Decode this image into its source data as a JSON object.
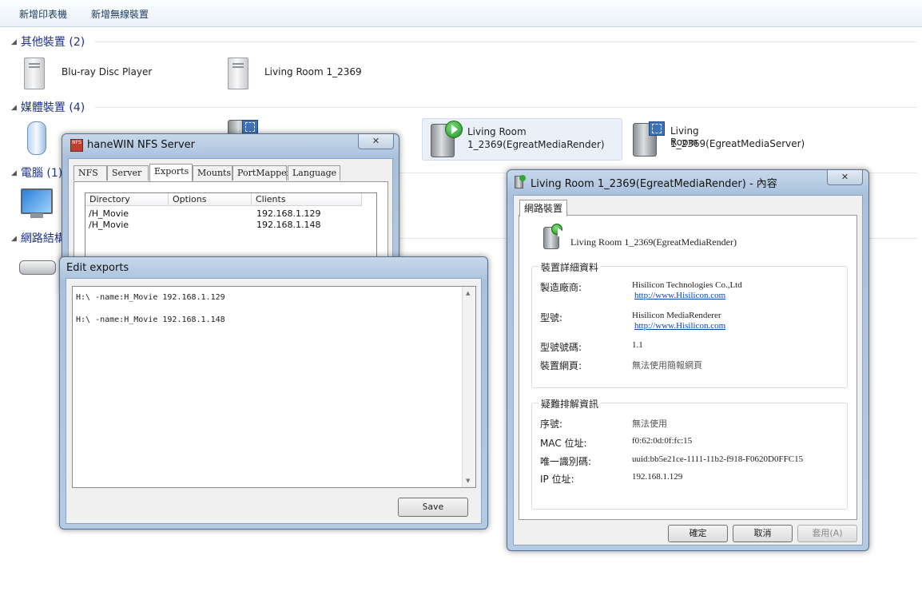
{
  "toolbar": {
    "add_printer": "新增印表機",
    "add_wireless": "新增無線裝置"
  },
  "groups": {
    "other": "其他裝置 (2)",
    "media": "媒體裝置 (4)",
    "computer": "電腦 (1)",
    "network": "網路結構"
  },
  "devices": {
    "bluray": "Blu-ray Disc Player",
    "living_room": "Living Room 1_2369",
    "media_render_line1": "Living Room",
    "media_render_line2": "1_2369(EgreatMediaRender)",
    "media_server_line1": "Living Room",
    "media_server_line2": "1_2369(EgreatMediaServer)"
  },
  "nfs": {
    "title": "haneWIN NFS Server",
    "close": "✕",
    "tabs": [
      "NFS",
      "Server",
      "Exports",
      "Mounts",
      "PortMapper",
      "Language"
    ],
    "columns": [
      "Directory",
      "Options",
      "Clients"
    ],
    "rows": [
      {
        "dir": "/H_Movie",
        "options": "",
        "clients": "192.168.1.129"
      },
      {
        "dir": "/H_Movie",
        "options": "",
        "clients": "192.168.1.148"
      }
    ]
  },
  "edit": {
    "title": "Edit exports",
    "line1": "H:\\ -name:H_Movie 192.168.1.129",
    "line2": "H:\\ -name:H_Movie 192.168.1.148",
    "save": "Save"
  },
  "props": {
    "title": "Living Room 1_2369(EgreatMediaRender) - 內容",
    "close": "✕",
    "tab": "網路裝置",
    "device_name": "Living Room 1_2369(EgreatMediaRender)",
    "details_header": "裝置詳細資料",
    "manufacturer_label": "製造廠商:",
    "manufacturer_value": "Hisilicon Technologies Co.,Ltd",
    "manufacturer_link": "http://www.Hisilicon.com",
    "model_label": "型號:",
    "model_value": "Hisilicon MediaRenderer",
    "model_link": "http://www.Hisilicon.com",
    "model_no_label": "型號號碼:",
    "model_no_value": "1.1",
    "webpage_label": "裝置網頁:",
    "webpage_value": "無法使用簡報網頁",
    "trouble_header": "疑難排解資訊",
    "serial_label": "序號:",
    "serial_value": "無法使用",
    "mac_label": "MAC 位址:",
    "mac_value": "f0:62:0d:0f:fc:15",
    "uid_label": "唯一識別碼:",
    "uid_value": "uuid:bb5e21ce-1111-11b2-f918-F0620D0FFC15",
    "ip_label": "IP 位址:",
    "ip_value": "192.168.1.129",
    "ok": "確定",
    "cancel": "取消",
    "apply": "套用(A)"
  }
}
